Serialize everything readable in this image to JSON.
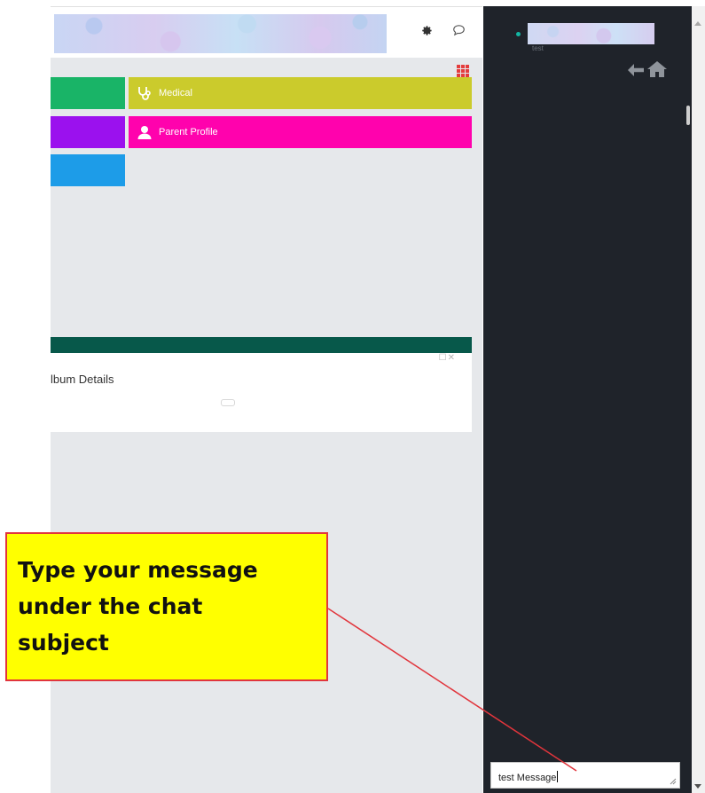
{
  "tiles": [
    {
      "label": "",
      "color": "#19b467"
    },
    {
      "label": "Medical",
      "color": "#cbcb2c",
      "icon": "stethoscope-icon"
    },
    {
      "label": "",
      "color": "#9b11ee"
    },
    {
      "label": "Parent Profile",
      "color": "#ff02ad",
      "icon": "user-icon"
    },
    {
      "label": "",
      "color": "#1d9ce8"
    }
  ],
  "album": {
    "title": "lbum Details",
    "controls": "☐✕"
  },
  "chat_panel": {
    "subject_sub": "test",
    "message_value": "test Message",
    "status_color": "#13b6a3"
  },
  "annotation": {
    "lines": [
      "Type your message",
      "under the chat",
      "subject"
    ],
    "background": "#ffff00",
    "border": "#e1353c"
  }
}
